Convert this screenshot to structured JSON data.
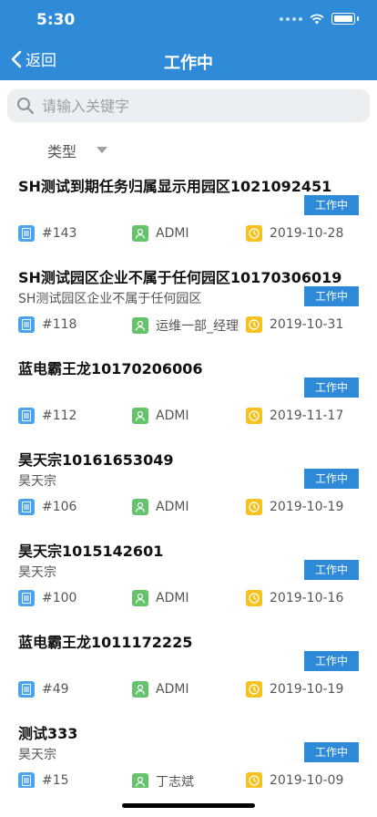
{
  "status_bar": {
    "time": "5:30"
  },
  "nav": {
    "back_label": "返回",
    "title": "工作中"
  },
  "search": {
    "placeholder": "请输入关键字"
  },
  "filter": {
    "label": "类型"
  },
  "items": [
    {
      "title": "SH测试到期任务归属显示用园区1021092451",
      "subtitle": "",
      "status": "工作中",
      "id": "#143",
      "user": "ADMI",
      "date": "2019-10-28"
    },
    {
      "title": "SH测试园区企业不属于任何园区10170306019",
      "subtitle": "SH测试园区企业不属于任何园区",
      "status": "工作中",
      "id": "#118",
      "user": "运维一部_经理",
      "date": "2019-10-31"
    },
    {
      "title": "蓝电霸王龙10170206006",
      "subtitle": "",
      "status": "工作中",
      "id": "#112",
      "user": "ADMI",
      "date": "2019-11-17"
    },
    {
      "title": "昊天宗10161653049",
      "subtitle": "昊天宗",
      "status": "工作中",
      "id": "#106",
      "user": "ADMI",
      "date": "2019-10-19"
    },
    {
      "title": "昊天宗1015142601",
      "subtitle": "昊天宗",
      "status": "工作中",
      "id": "#100",
      "user": "ADMI",
      "date": "2019-10-16"
    },
    {
      "title": "蓝电霸王龙1011172225",
      "subtitle": "",
      "status": "工作中",
      "id": "#49",
      "user": "ADMI",
      "date": "2019-10-19"
    },
    {
      "title": "测试333",
      "subtitle": "昊天宗",
      "status": "工作中",
      "id": "#15",
      "user": "丁志斌",
      "date": "2019-10-09"
    }
  ],
  "colors": {
    "accent": "#2f8bd8",
    "doc_icon": "#4aa3ef",
    "user_icon": "#64c36b",
    "clock_icon": "#f5c320"
  },
  "icons": {
    "back": "chevron-left-icon",
    "search": "search-icon",
    "filter": "caret-down-icon",
    "doc": "document-icon",
    "user": "user-icon",
    "clock": "clock-icon"
  }
}
